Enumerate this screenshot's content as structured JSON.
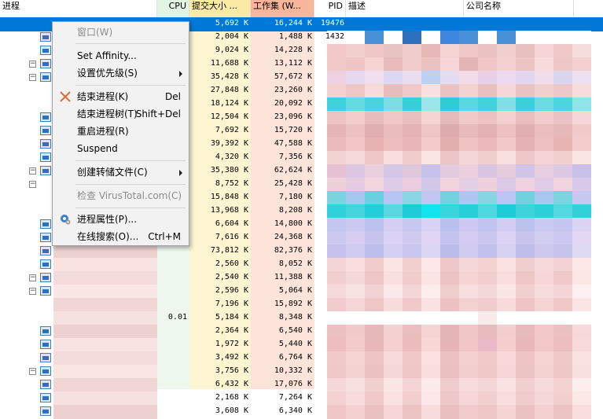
{
  "columns": {
    "process": "进程",
    "cpu": "CPU",
    "commit": "提交大小 ...",
    "working_set": "工作集 (W...",
    "pid": "PID",
    "description": "描述",
    "company": "公司名称"
  },
  "rows": [
    {
      "cpu": "",
      "commit": "5,692 K",
      "ws": "16,244 K",
      "pid": "19476",
      "selected": true,
      "expander": false,
      "icon": false,
      "colors": []
    },
    {
      "cpu": "",
      "commit": "2,004 K",
      "ws": "1,488 K",
      "pid": "1432",
      "expander": false,
      "icon": true,
      "colors": [
        "#ffffff",
        "#ffffff",
        "#4a90d9",
        "#ffffff",
        "#2f6fbf",
        "#ffffff",
        "#3f86e0",
        "#4a90d9",
        "#ffffff",
        "#4a90d9",
        "#ffffff",
        "#ffffff",
        "#ffffff",
        "#ffffff"
      ]
    },
    {
      "cpu": "",
      "commit": "9,024 K",
      "ws": "14,228 K",
      "pid": "",
      "expander": false,
      "icon": true,
      "colors": [
        "#f5c9c9",
        "#f3cfcf",
        "#eec6c6",
        "#e9c4c4",
        "#f1cccc",
        "#e6b8b8",
        "#f4d3d3",
        "#f0c8c8",
        "#ebc3c3",
        "#f3d0d0",
        "#e8c0c0",
        "#f5d5d5",
        "#efc9c9",
        "#f7dede"
      ]
    },
    {
      "cpu": "",
      "commit": "11,688 K",
      "ws": "13,112 K",
      "pid": "",
      "expander": true,
      "icon": true,
      "colors": [
        "#f3caca",
        "#eec4c4",
        "#f6d4d4",
        "#e8bcbc",
        "#f1cccc",
        "#eac2c2",
        "#f6d6d6",
        "#e3b6b6",
        "#f0c6c6",
        "#f4d0d0",
        "#ecc4c4",
        "#f7dada",
        "#edc6c6",
        "#f4d0d0"
      ]
    },
    {
      "cpu": "",
      "commit": "35,428 K",
      "ws": "57,672 K",
      "pid": "",
      "expander": true,
      "icon": true,
      "colors": [
        "#eed2e4",
        "#e6d8ee",
        "#f0e0ef",
        "#dcd8f2",
        "#e8def0",
        "#bcd2f4",
        "#e4dcf0",
        "#f2dcea",
        "#e8d0e6",
        "#eedaf0",
        "#e2d6ee",
        "#f0dcea",
        "#dad6f0",
        "#ece0f2"
      ]
    },
    {
      "cpu": "",
      "commit": "27,848 K",
      "ws": "23,260 K",
      "pid": "",
      "expander": false,
      "icon": false,
      "colors": [
        "#f5d0d0",
        "#eec6c6",
        "#f7dada",
        "#e6bcbc",
        "#f0caca",
        "#f9e0e0",
        "#ebc2c2",
        "#f4d2d2",
        "#e8c0c0",
        "#f6d8d8",
        "#eac4c4",
        "#f3d0d0",
        "#eec8c8",
        "#f8dcdc"
      ]
    },
    {
      "cpu": "",
      "commit": "18,124 K",
      "ws": "20,092 K",
      "pid": "",
      "expander": false,
      "icon": false,
      "colors": [
        "#3ed2da",
        "#64dce2",
        "#48d4de",
        "#7cdee4",
        "#36d0d8",
        "#9ce6ea",
        "#2ecdd6",
        "#58d8e0",
        "#42d2dc",
        "#80e0e6",
        "#3ad0da",
        "#6adce2",
        "#4cd6de",
        "#8ee4e8"
      ]
    },
    {
      "cpu": "",
      "commit": "12,504 K",
      "ws": "23,096 K",
      "pid": "",
      "expander": false,
      "icon": true,
      "colors": [
        "#edc4c4",
        "#f3cccc",
        "#e6bcbc",
        "#f0c8c8",
        "#e9c0c0",
        "#f6d4d4",
        "#e4baba",
        "#f1caca",
        "#ecc2c2",
        "#f4d0d0",
        "#e8bebe",
        "#f2cccc",
        "#eac4c4",
        "#f6d6d6"
      ]
    },
    {
      "cpu": "",
      "commit": "7,692 K",
      "ws": "15,720 K",
      "pid": "",
      "expander": false,
      "icon": true,
      "colors": [
        "#e6b6b6",
        "#eec2c2",
        "#e0b0b0",
        "#ebbcbc",
        "#e4b4b4",
        "#f0c6c6",
        "#dcacac",
        "#e9baba",
        "#e2b2b2",
        "#eec0c0",
        "#e0b0b0",
        "#ecbebe",
        "#e6b8b8",
        "#f2caca"
      ]
    },
    {
      "cpu": "",
      "commit": "39,392 K",
      "ws": "47,588 K",
      "pid": "",
      "expander": false,
      "icon": true,
      "colors": [
        "#ecbaba",
        "#f2c6c6",
        "#e6b2b2",
        "#eebebe",
        "#e8b6b6",
        "#f4caca",
        "#e2aeae",
        "#f0c2c2",
        "#eab8b8",
        "#f2c8c8",
        "#e4b2b2",
        "#eec0c0",
        "#e8b4b4",
        "#f4cccc"
      ]
    },
    {
      "cpu": "",
      "commit": "4,320 K",
      "ws": "7,356 K",
      "pid": "",
      "expander": false,
      "icon": true,
      "colors": [
        "#f3d2d2",
        "#f6dada",
        "#eec8c8",
        "#f8dede",
        "#f0cccc",
        "#fae4e4",
        "#ecc6c6",
        "#f5d6d6",
        "#f1cece",
        "#f8e0e0",
        "#eec8c8",
        "#f4d4d4",
        "#f2d0d0",
        "#fbe6e6"
      ]
    },
    {
      "cpu": "",
      "commit": "35,380 K",
      "ws": "62,624 K",
      "pid": "",
      "expander": true,
      "icon": true,
      "colors": [
        "#e6c2d2",
        "#dcc6e2",
        "#ead0de",
        "#d4c8e6",
        "#e0c8dc",
        "#c6c2ea",
        "#e4cade",
        "#eccfdc",
        "#d8c6e4",
        "#e6ccdc",
        "#d0c4e8",
        "#e8cede",
        "#dcc8e2",
        "#c8c2ea"
      ]
    },
    {
      "cpu": "",
      "commit": "8,752 K",
      "ws": "25,428 K",
      "pid": "",
      "expander": true,
      "icon": false,
      "colors": [
        "#eed0d8",
        "#e6cce2",
        "#f2d6de",
        "#dccce8",
        "#eacee0",
        "#d2c8ea",
        "#f0d4dc",
        "#e4cee4",
        "#ecd0dc",
        "#dacae8",
        "#eed2de",
        "#e0cce6",
        "#f0d4de",
        "#d8c8ea"
      ]
    },
    {
      "cpu": "",
      "commit": "15,848 K",
      "ws": "7,180 K",
      "pid": "",
      "expander": false,
      "icon": false,
      "colors": [
        "#7ad4e0",
        "#a4c8f0",
        "#68d0de",
        "#b8c4f4",
        "#8ad6e2",
        "#c2c6f2",
        "#74d2e0",
        "#b0c6f2",
        "#86d6e2",
        "#bcc4f4",
        "#70d2de",
        "#a8c8f0",
        "#7cd4e0",
        "#c6c8f2"
      ]
    },
    {
      "cpu": "",
      "commit": "13,968 K",
      "ws": "8,208 K",
      "pid": "",
      "expander": false,
      "icon": false,
      "colors": [
        "#2ed2da",
        "#44d6de",
        "#22cfd8",
        "#5ad8e0",
        "#1ccdd6",
        "#10e4ec",
        "#38d4dc",
        "#26d0d8",
        "#4ed8e0",
        "#1acdd6",
        "#3cd4dc",
        "#2ad0d8",
        "#52d8e0",
        "#30d2da"
      ]
    },
    {
      "cpu": "",
      "commit": "6,604 K",
      "ws": "14,800 K",
      "pid": "",
      "expander": false,
      "icon": true,
      "colors": [
        "#c2c6f0",
        "#cccaf2",
        "#bcc2ee",
        "#d4cef2",
        "#c6c8f0",
        "#d8d2f4",
        "#b8c0ee",
        "#cec8f2",
        "#c0c4ee",
        "#d2ccf2",
        "#bac2ee",
        "#cacaf2",
        "#c4c6f0",
        "#dcd4f4"
      ]
    },
    {
      "cpu": "",
      "commit": "7,616 K",
      "ws": "24,368 K",
      "pid": "",
      "expander": false,
      "icon": true,
      "colors": [
        "#ccc8f0",
        "#d6cef2",
        "#c6c4ee",
        "#dad2f4",
        "#d0caf0",
        "#e0d6f4",
        "#c4c2ee",
        "#d4ccf2",
        "#cac6f0",
        "#dcd4f4",
        "#c8c4ee",
        "#d2cef2",
        "#ccc8f0",
        "#e2d8f4"
      ]
    },
    {
      "cpu": "",
      "commit": "73,812 K",
      "ws": "82,376 K",
      "pid": "",
      "expander": false,
      "icon": true,
      "colors": [
        "#c4c2ec",
        "#ceccf0",
        "#bebeea",
        "#d4d0f2",
        "#c8c6ee",
        "#dad6f4",
        "#bcbcea",
        "#d0ccf0",
        "#c2c0ec",
        "#d6d2f2",
        "#c0beea",
        "#ccc8ee",
        "#c6c4ec",
        "#dedaf4"
      ]
    },
    {
      "cpu": "",
      "commit": "2,560 K",
      "ws": "8,052 K",
      "pid": "",
      "expander": false,
      "icon": true,
      "colors": [
        "#f4d4d4",
        "#f8dede",
        "#f0cccc",
        "#fae4e4",
        "#f2d0d0",
        "#fce8e8",
        "#eec8c8",
        "#f6d8d8",
        "#f4d2d2",
        "#fae2e2",
        "#f0cece",
        "#f6dada",
        "#f2d2d2",
        "#fde8e8"
      ]
    },
    {
      "cpu": "",
      "commit": "2,540 K",
      "ws": "11,388 K",
      "pid": "",
      "expander": true,
      "icon": true,
      "colors": [
        "#f3d0d0",
        "#f7d8d8",
        "#eec8c8",
        "#f9e0e0",
        "#f1cccc",
        "#fbe4e4",
        "#ecc4c4",
        "#f5d4d4",
        "#f2cece",
        "#f9dede",
        "#eec6c6",
        "#f6d6d6",
        "#f0caca",
        "#fce6e6"
      ]
    },
    {
      "cpu": "",
      "commit": "2,596 K",
      "ws": "5,064 K",
      "pid": "",
      "expander": true,
      "icon": true,
      "colors": [
        "#f6dada",
        "#f9e2e2",
        "#f2d2d2",
        "#fbe8e8",
        "#f4d6d6",
        "#fdeeee",
        "#f0cece",
        "#f8dede",
        "#f5d8d8",
        "#fbe6e6",
        "#f2d0d0",
        "#f8dcdc",
        "#f4d4d4",
        "#fef0f0"
      ]
    },
    {
      "cpu": "",
      "commit": "7,196 K",
      "ws": "15,892 K",
      "pid": "",
      "expander": false,
      "icon": false,
      "colors": [
        "#f2cccc",
        "#f6d6d6",
        "#eec6c6",
        "#f8dcdc",
        "#f0caca",
        "#fae2e2",
        "#ecc2c2",
        "#f4d2d2",
        "#f1cccc",
        "#f8dada",
        "#eec4c4",
        "#f5d4d4",
        "#f0c8c8",
        "#fbe4e4"
      ]
    },
    {
      "cpu": "0.01",
      "commit": "5,184 K",
      "ws": "8,348 K",
      "pid": "",
      "expander": false,
      "icon": false,
      "colors": [
        "#ffffff",
        "#ffffff",
        "#ffffff",
        "#ffffff",
        "#ffffff",
        "#ffffff",
        "#ffffff",
        "#ffffff",
        "#f8eaea",
        "#ffffff",
        "#ffffff",
        "#ffffff",
        "#ffffff",
        "#ffffff"
      ]
    },
    {
      "cpu": "",
      "commit": "2,364 K",
      "ws": "6,540 K",
      "pid": "",
      "expander": false,
      "icon": true,
      "colors": [
        "#ecc0c0",
        "#f2caca",
        "#e6b8b8",
        "#f4d0d0",
        "#eabebe",
        "#f6d4d4",
        "#e4b6b6",
        "#f0c6c6",
        "#e8bcbc",
        "#f4cece",
        "#e6baba",
        "#f2c8c8",
        "#eac0c0",
        "#f8d8d8"
      ]
    },
    {
      "cpu": "",
      "commit": "1,972 K",
      "ws": "5,440 K",
      "pid": "",
      "expander": false,
      "icon": true,
      "colors": [
        "#eebebe",
        "#f4caca",
        "#e8b8b8",
        "#f6d0d0",
        "#ecbcbc",
        "#f8d6d6",
        "#e6b6b6",
        "#f2c6c6",
        "#eabaca",
        "#f6cece",
        "#e8b8b8",
        "#f4c8c8",
        "#ecbebe",
        "#f9dada"
      ]
    },
    {
      "cpu": "",
      "commit": "3,492 K",
      "ws": "6,764 K",
      "pid": "",
      "expander": false,
      "icon": true,
      "colors": [
        "#f2caca",
        "#f6d4d4",
        "#eec4c4",
        "#f8dada",
        "#f0c8c8",
        "#fae0e0",
        "#ecc2c2",
        "#f4d0d0",
        "#f1caca",
        "#f8d8d8",
        "#eec4c4",
        "#f6d4d4",
        "#f0c8c8",
        "#fbe2e2"
      ]
    },
    {
      "cpu": "",
      "commit": "3,756 K",
      "ws": "10,332 K",
      "pid": "",
      "expander": true,
      "icon": true,
      "colors": [
        "#f0c8c8",
        "#f4d2d2",
        "#ecc2c2",
        "#f6d8d8",
        "#eec6c6",
        "#f8dede",
        "#eac0c0",
        "#f2cece",
        "#efc8c8",
        "#f6d6d6",
        "#ecc4c4",
        "#f4d2d2",
        "#eec6c6",
        "#f9e0e0"
      ]
    },
    {
      "cpu": "",
      "commit": "6,432 K",
      "ws": "17,076 K",
      "pid": "",
      "expander": false,
      "icon": true,
      "colors": [
        "#f6d8d8",
        "#f9e0e0",
        "#f2d0d0",
        "#fbe6e6",
        "#f4d4d4",
        "#fdeaea",
        "#f0cccc",
        "#f8dcdc",
        "#f5d6d6",
        "#fae2e2",
        "#f2d0d0",
        "#f7dada",
        "#f4d2d2",
        "#fdeeee"
      ]
    },
    {
      "cpu": "",
      "commit": "2,168 K",
      "ws": "7,264 K",
      "pid": "",
      "expander": false,
      "icon": true,
      "colors": [
        "#f4d2d2",
        "#f8dcdc",
        "#f0caca",
        "#fae2e2",
        "#f2cece",
        "#fce8e8",
        "#eec8c8",
        "#f6d6d6",
        "#f3d0d0",
        "#f9dede",
        "#f0cccc",
        "#f6d8d8",
        "#f2cece",
        "#fde8e8"
      ]
    },
    {
      "cpu": "",
      "commit": "3,608 K",
      "ws": "6,340 K",
      "pid": "",
      "expander": false,
      "icon": true,
      "colors": [
        "#eec6c6",
        "#f4d0d0",
        "#eac0c0",
        "#f6d6d6",
        "#ecc4c4",
        "#f8dcdc",
        "#e8bebe",
        "#f2cccc",
        "#edc6c6",
        "#f6d4d4",
        "#eac2c2",
        "#f4d0d0",
        "#ecc4c4",
        "#f9dede"
      ]
    }
  ],
  "name_blur": [
    "#f8e2e2",
    "#f4dcdc",
    "#fbe6e6",
    "#f1d6d6",
    "#f7e0e0",
    "#eed2d2"
  ],
  "context_menu": {
    "window": "窗口(W)",
    "set_affinity": "Set Affinity...",
    "set_priority": "设置优先级(S)",
    "kill_process": "结束进程(K)",
    "kill_process_shortcut": "Del",
    "kill_tree": "结束进程树(T)",
    "kill_tree_shortcut": "Shift+Del",
    "restart": "重启进程(R)",
    "suspend": "Suspend",
    "create_dump": "创建转储文件(C)",
    "check_virustotal": "检查 VirusTotal.com(C)",
    "properties": "进程属性(P)...",
    "search_online": "在线搜索(O)...",
    "search_online_shortcut": "Ctrl+M"
  },
  "colors": {
    "selection": "#0078d7",
    "kill_icon": "#e06a3a",
    "menu_bg": "#f2f2f2"
  }
}
